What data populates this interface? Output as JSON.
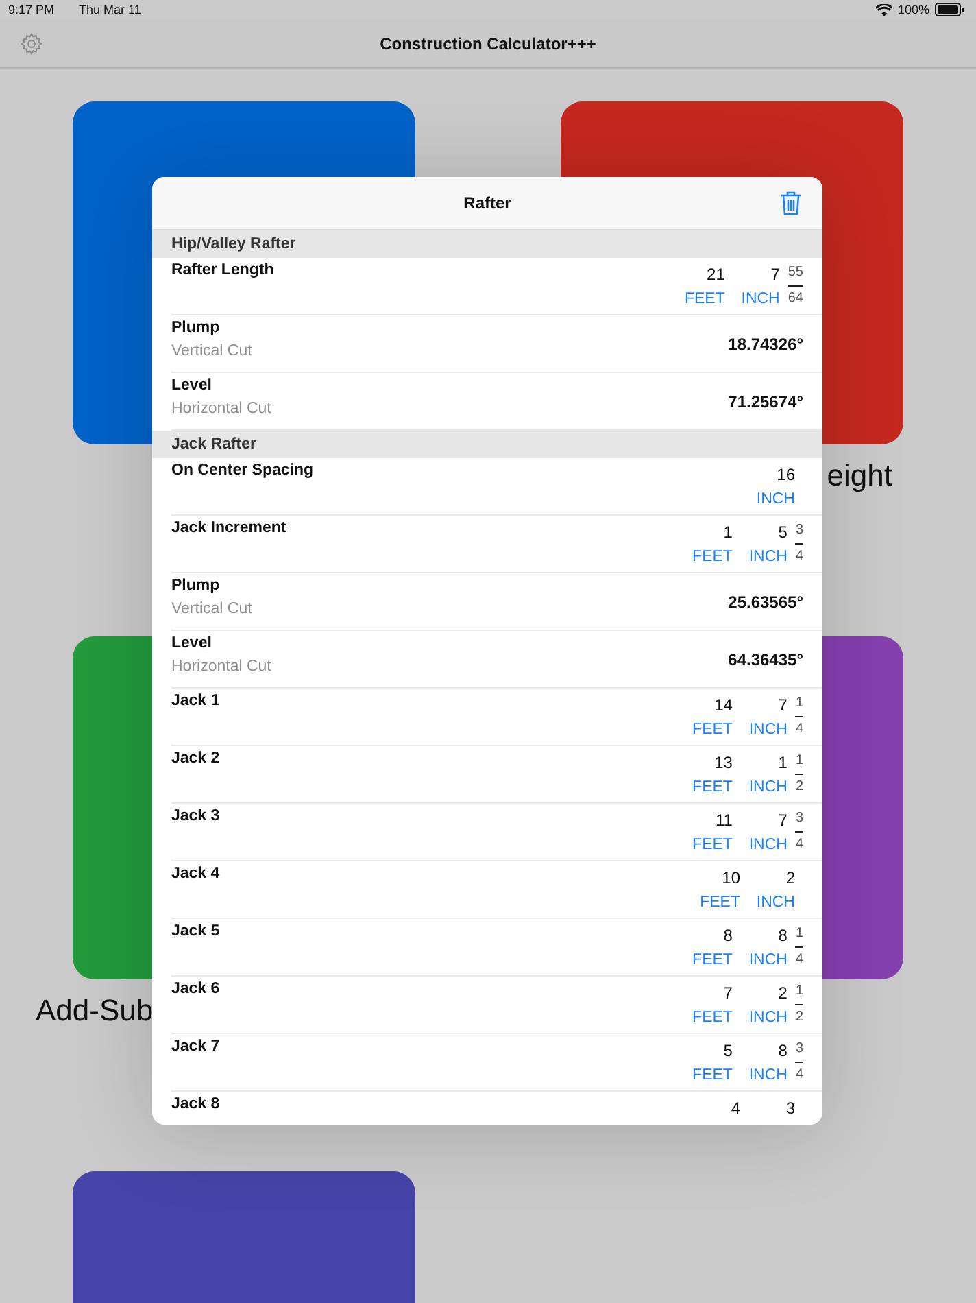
{
  "status_bar": {
    "time": "9:17 PM",
    "date": "Thu Mar 11",
    "battery": "100%"
  },
  "nav_bar": {
    "title": "Construction Calculator+++"
  },
  "tiles": [
    {
      "color": "#0062c8"
    },
    {
      "color": "#c4281f",
      "label": "eight"
    },
    {
      "color": "#239a3c",
      "label": "Add-Sub"
    },
    {
      "color": "#8540b0"
    },
    {
      "color": "#4544a8"
    }
  ],
  "popup": {
    "title": "Rafter",
    "rows": [
      {
        "kind": "section",
        "title": "Hip/Valley Rafter"
      },
      {
        "kind": "length",
        "title": "Rafter Length",
        "feet": "21",
        "inch": "7",
        "numerator": "55",
        "denominator": "64",
        "feet_unit": "FEET",
        "inch_unit": "INCH"
      },
      {
        "kind": "angle",
        "title": "Plump",
        "subtitle": "Vertical Cut",
        "value": "18.74326°"
      },
      {
        "kind": "angle",
        "title": "Level",
        "subtitle": "Horizontal Cut",
        "value": "71.25674°"
      },
      {
        "kind": "section",
        "title": "Jack Rafter"
      },
      {
        "kind": "inches",
        "title": "On Center Spacing",
        "inch": "16",
        "inch_unit": "INCH"
      },
      {
        "kind": "length",
        "title": "Jack Increment",
        "feet": "1",
        "inch": "5",
        "numerator": "3",
        "denominator": "4",
        "feet_unit": "FEET",
        "inch_unit": "INCH"
      },
      {
        "kind": "angle",
        "title": "Plump",
        "subtitle": "Vertical Cut",
        "value": "25.63565°"
      },
      {
        "kind": "angle",
        "title": "Level",
        "subtitle": "Horizontal Cut",
        "value": "64.36435°"
      },
      {
        "kind": "length",
        "title": "Jack 1",
        "feet": "14",
        "inch": "7",
        "numerator": "1",
        "denominator": "4",
        "feet_unit": "FEET",
        "inch_unit": "INCH"
      },
      {
        "kind": "length",
        "title": "Jack 2",
        "feet": "13",
        "inch": "1",
        "numerator": "1",
        "denominator": "2",
        "feet_unit": "FEET",
        "inch_unit": "INCH"
      },
      {
        "kind": "length",
        "title": "Jack 3",
        "feet": "11",
        "inch": "7",
        "numerator": "3",
        "denominator": "4",
        "feet_unit": "FEET",
        "inch_unit": "INCH"
      },
      {
        "kind": "length",
        "title": "Jack 4",
        "feet": "10",
        "inch": "2",
        "feet_unit": "FEET",
        "inch_unit": "INCH"
      },
      {
        "kind": "length",
        "title": "Jack 5",
        "feet": "8",
        "inch": "8",
        "numerator": "1",
        "denominator": "4",
        "feet_unit": "FEET",
        "inch_unit": "INCH"
      },
      {
        "kind": "length",
        "title": "Jack 6",
        "feet": "7",
        "inch": "2",
        "numerator": "1",
        "denominator": "2",
        "feet_unit": "FEET",
        "inch_unit": "INCH"
      },
      {
        "kind": "length",
        "title": "Jack 7",
        "feet": "5",
        "inch": "8",
        "numerator": "3",
        "denominator": "4",
        "feet_unit": "FEET",
        "inch_unit": "INCH"
      },
      {
        "kind": "length",
        "title": "Jack 8",
        "feet": "4",
        "inch": "3"
      }
    ]
  }
}
